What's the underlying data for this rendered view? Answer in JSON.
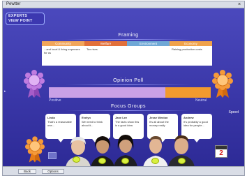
{
  "window": {
    "title": "Pewtter",
    "close_glyph": "×"
  },
  "logo": {
    "line1": "EXPERTS",
    "line2": "VIEW POINT"
  },
  "framing": {
    "title": "Framing",
    "columns": [
      {
        "header": "Community",
        "text": "...and local & living expenses for us",
        "color": "#f2a65a"
      },
      {
        "header": "Welfare",
        "text": "Tax rises",
        "color": "#e2703a"
      },
      {
        "header": "Environment",
        "text": "",
        "color": "#6fa8d6"
      },
      {
        "header": "Economy",
        "text": "Raising production costs",
        "color": "#f0a24a"
      }
    ]
  },
  "opinion": {
    "title": "Opinion Poll",
    "left_label": "Positive",
    "right_label": "Neutral",
    "value_fraction": 0.72
  },
  "focus_groups": {
    "title": "Focus Groups",
    "bubbles": [
      {
        "who": "Linda",
        "text": "That's a reasonable one..."
      },
      {
        "who": "Evelyn",
        "text": "We need to think about it..."
      },
      {
        "who": "Jane Lee",
        "text": "The facts show this is a good idea"
      },
      {
        "who": "Jesse Weston",
        "text": "It's all about the money really"
      },
      {
        "who": "Andrew",
        "text": "It's probably a good idea for people..."
      }
    ]
  },
  "speed": {
    "label": "Speed"
  },
  "calendar": {
    "number": "2"
  },
  "statusbar": {
    "button1": "Back",
    "button2": "Options"
  },
  "colors": {
    "background": "#3a37a8",
    "opinion_positive": "#c9a0e6",
    "opinion_neutral": "#f29a2e",
    "badge": "#d8f040"
  },
  "icons": [
    "rosette-purple-icon",
    "rosette-orange-icon",
    "calendar-icon",
    "grid-icon",
    "close-icon"
  ]
}
